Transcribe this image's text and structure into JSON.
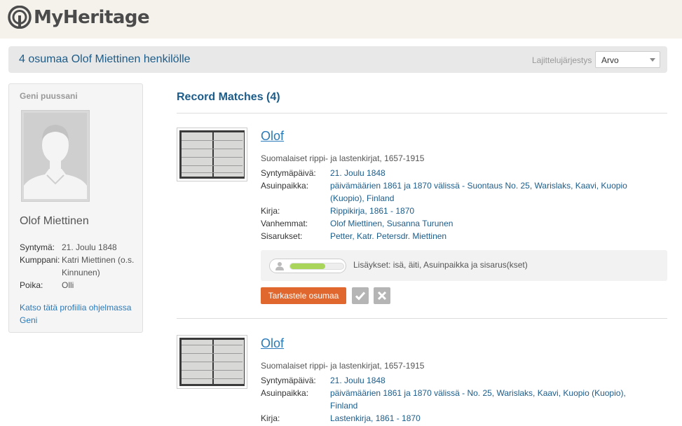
{
  "brand": {
    "name": "MyHeritage"
  },
  "results": {
    "title": "4 osumaa Olof Miettinen henkilölle",
    "sort_label": "Lajittelujärjestys",
    "sort_value": "Arvo"
  },
  "sidebar": {
    "heading": "Geni puussani",
    "name": "Olof Miettinen",
    "facts": [
      {
        "key": "Syntymä:",
        "value": "21. Joulu 1848"
      },
      {
        "key": "Kumppani:",
        "value": "Katri Miettinen (o.s. Kinnunen)"
      },
      {
        "key": "Poika:",
        "value": "Olli"
      }
    ],
    "link": "Katso tätä profiilia ohjelmassa Geni"
  },
  "matches": {
    "title": "Record Matches (4)",
    "records": [
      {
        "name": "Olof",
        "collection": "Suomalaiset rippi- ja lastenkirjat, 1657-1915",
        "facts": [
          {
            "key": "Syntymäpäivä:",
            "value": "21. Joulu 1848"
          },
          {
            "key": "Asuinpaikka:",
            "value": "päivämäärien 1861 ja 1870 välissä - Suontaus No. 25, Warislaks, Kaavi, Kuopio (Kuopio), Finland"
          },
          {
            "key": "Kirja:",
            "value": "Rippikirja, 1861 - 1870"
          },
          {
            "key": "Vanhemmat:",
            "value": "Olof Miettinen, Susanna Turunen"
          },
          {
            "key": "Sisarukset:",
            "value": "Petter, Katr. Petersdr. Miettinen"
          }
        ],
        "extras_text": "Lisäykset: isä, äiti, Asuinpaikka ja sisarus(kset)",
        "meter_level": 0.66,
        "view_button": "Tarkastele osumaa"
      },
      {
        "name": "Olof",
        "collection": "Suomalaiset rippi- ja lastenkirjat, 1657-1915",
        "facts": [
          {
            "key": "Syntymäpäivä:",
            "value": "21. Joulu 1848"
          },
          {
            "key": "Asuinpaikka:",
            "value": "päivämäärien 1861 ja 1870 välissä - No. 25, Warislaks, Kaavi, Kuopio (Kuopio), Finland"
          },
          {
            "key": "Kirja:",
            "value": "Lastenkirja, 1861 - 1870"
          }
        ]
      }
    ]
  },
  "colors": {
    "link": "#2a7ab9",
    "heading": "#1c5c8a",
    "accent_button": "#e0682e",
    "meter_fill": "#a9d65a"
  },
  "icons": [
    "myheritage-logo-icon",
    "person-icon",
    "check-icon",
    "close-icon",
    "chevron-down-icon"
  ]
}
